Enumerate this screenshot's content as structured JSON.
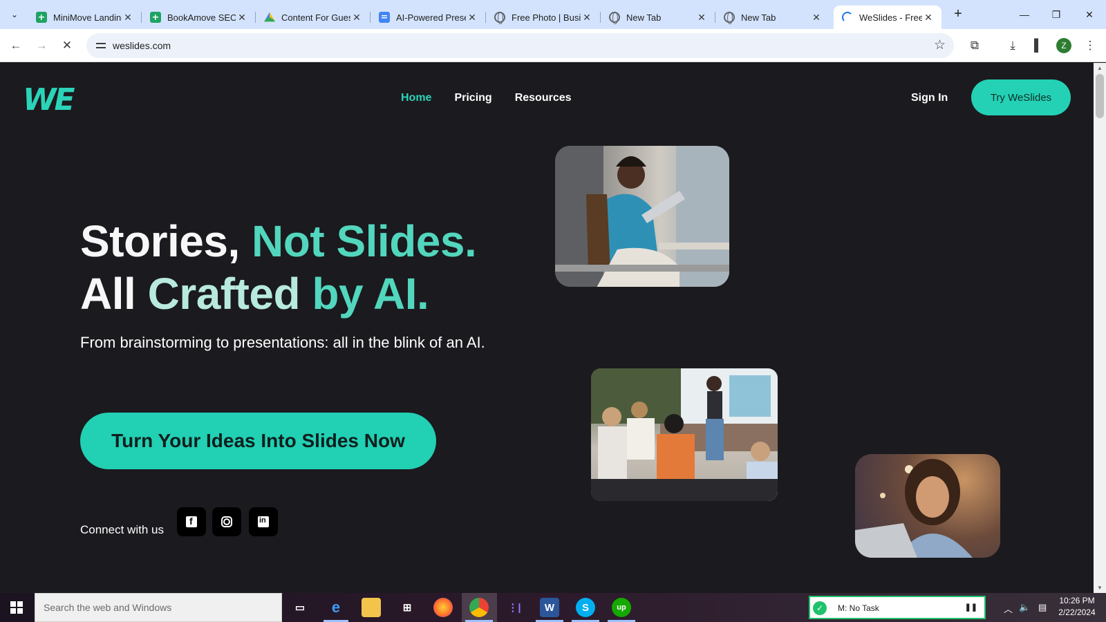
{
  "browser": {
    "tabs": [
      {
        "title": "MiniMove Landing",
        "icon": "sheets-icon"
      },
      {
        "title": "BookAmove SEO",
        "icon": "sheets-icon"
      },
      {
        "title": "Content For Guest",
        "icon": "drive-icon"
      },
      {
        "title": "AI-Powered Presentation",
        "icon": "docs-icon"
      },
      {
        "title": "Free Photo | Business",
        "icon": "globe-icon"
      },
      {
        "title": "New Tab",
        "icon": "globe-icon"
      },
      {
        "title": "New Tab",
        "icon": "globe-icon"
      },
      {
        "title": "WeSlides - Free AI",
        "icon": "loading-icon",
        "active": true
      }
    ],
    "url": "weslides.com",
    "profile_initial": "Z"
  },
  "site": {
    "logo": "WE",
    "nav": [
      "Home",
      "Pricing",
      "Resources"
    ],
    "active_nav": "Home",
    "sign_in": "Sign In",
    "try_button": "Try WeSlides",
    "headline": {
      "line1_white": "Stories, ",
      "line1_teal": "Not Slides.",
      "line2_white": "All ",
      "line2_light": "Crafted ",
      "line2_teal": "by AI."
    },
    "subheadline": "From brainstorming to presentations: all in the blink of an AI.",
    "cta": "Turn Your Ideas Into Slides Now",
    "connect": "Connect with us",
    "social": [
      "facebook-icon",
      "instagram-icon",
      "linkedin-icon"
    ]
  },
  "taskbar": {
    "search_placeholder": "Search the web and Windows",
    "task_widget": "M: No Task",
    "time": "10:26 PM",
    "date": "2/22/2024"
  },
  "colors": {
    "accent": "#24d1b5",
    "page_bg": "#1b1a1e",
    "tabstrip": "#d3e3fd"
  }
}
